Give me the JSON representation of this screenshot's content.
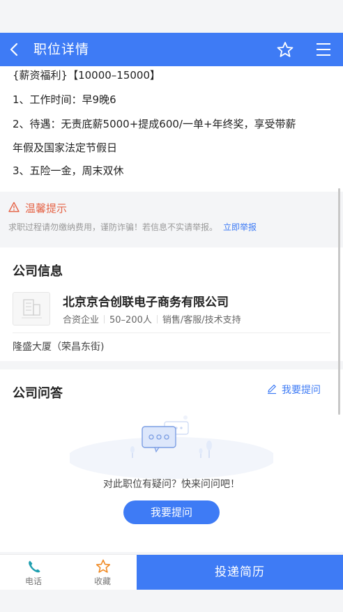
{
  "navbar": {
    "title": "职位详情",
    "icons": [
      "back-arrow-icon",
      "star-icon",
      "menu-icon"
    ]
  },
  "job_description": {
    "lines": [
      "{薪资福利}【10000–15000】",
      "1、工作时间：早9晚6",
      "2、待遇：无责底薪5000+提成600/一单+年终奖，享受带薪",
      "年假及国家法定节假日",
      "3、五险一金，周末双休"
    ]
  },
  "tips": {
    "title": "温馨提示",
    "text": "求职过程请勿缴纳费用，谨防诈骗！若信息不实请举报。",
    "report_link": "立即举报",
    "color": "#e56447"
  },
  "company": {
    "section_title": "公司信息",
    "name": "北京京合创联电子商务有限公司",
    "type": "合资企业",
    "size": "50–200人",
    "industry": "销售/客服/技术支持",
    "address": "隆盛大厦（荣昌东街)"
  },
  "qa": {
    "section_title": "公司问答",
    "ask_link": "我要提问",
    "empty_prompt": "对此职位有疑问？快来问问吧！",
    "ask_button": "我要提问"
  },
  "bottom_bar": {
    "phone_label": "电话",
    "favorite_label": "收藏",
    "apply_button": "投递简历"
  },
  "colors": {
    "primary": "#3e7bf5",
    "background": "#f4f5f7",
    "warning": "#e56447"
  }
}
